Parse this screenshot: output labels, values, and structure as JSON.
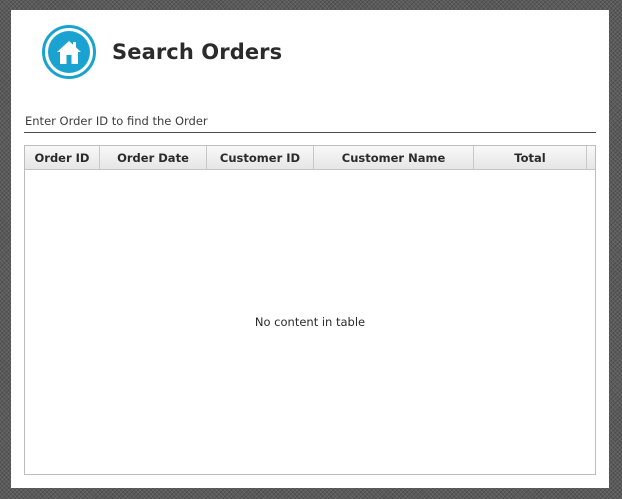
{
  "header": {
    "title": "Search Orders",
    "home_icon": "home-icon",
    "accent_color": "#1aa3d1"
  },
  "search": {
    "placeholder": "Enter Order ID to find the Order",
    "value": ""
  },
  "table": {
    "columns": [
      "Order ID",
      "Order Date",
      "Customer ID",
      "Customer Name",
      "Total"
    ],
    "rows": [],
    "empty_message": "No content in table"
  }
}
